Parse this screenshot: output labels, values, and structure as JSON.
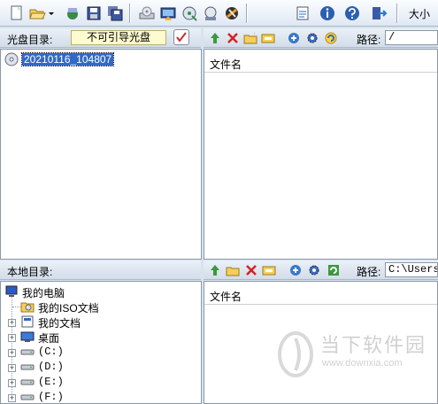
{
  "toolbar": {
    "size_label": "大小",
    "buttons": [
      "new-icon",
      "open-icon",
      "save-as-icon",
      "save-icon",
      "save-all-icon",
      "burn-icon",
      "extract-icon",
      "mount-icon",
      "network-icon",
      "optimize-icon",
      "properties-icon",
      "info-icon",
      "help-icon",
      "exit-icon"
    ]
  },
  "disc_panel": {
    "label": "光盘目录:",
    "boot_status": "不可引导光盘",
    "root_item": "20210116_104807"
  },
  "disc_files": {
    "path_label": "路径:",
    "path_value": "/",
    "column_filename": "文件名"
  },
  "local_panel": {
    "label": "本地目录:",
    "tree": [
      {
        "label": "我的电脑"
      },
      {
        "label": "我的ISO文档"
      },
      {
        "label": "我的文档"
      },
      {
        "label": "桌面"
      },
      {
        "label": "(C:)"
      },
      {
        "label": "(D:)"
      },
      {
        "label": "(E:)"
      },
      {
        "label": "(F:)"
      }
    ]
  },
  "local_files": {
    "path_label": "路径:",
    "path_value": "C:\\Users\\",
    "column_filename": "文件名"
  },
  "watermark": {
    "title": "当下软件园",
    "url": "www.downxia.com"
  },
  "colors": {
    "accent_selection": "#3169c6",
    "pane_background": "#d8e3ee"
  }
}
